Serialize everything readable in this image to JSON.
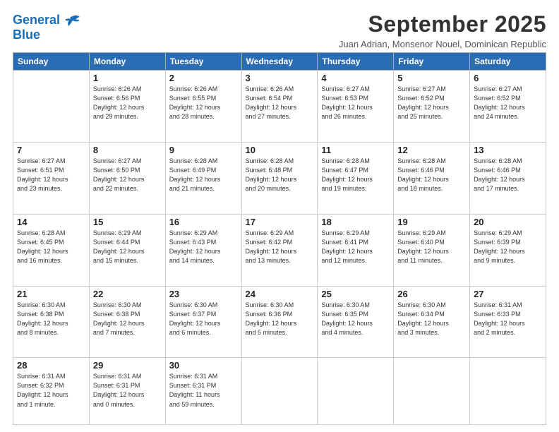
{
  "header": {
    "logo_line1": "General",
    "logo_line2": "Blue",
    "month": "September 2025",
    "location": "Juan Adrian, Monsenor Nouel, Dominican Republic"
  },
  "days_of_week": [
    "Sunday",
    "Monday",
    "Tuesday",
    "Wednesday",
    "Thursday",
    "Friday",
    "Saturday"
  ],
  "weeks": [
    [
      {
        "day": "",
        "info": ""
      },
      {
        "day": "1",
        "info": "Sunrise: 6:26 AM\nSunset: 6:56 PM\nDaylight: 12 hours\nand 29 minutes."
      },
      {
        "day": "2",
        "info": "Sunrise: 6:26 AM\nSunset: 6:55 PM\nDaylight: 12 hours\nand 28 minutes."
      },
      {
        "day": "3",
        "info": "Sunrise: 6:26 AM\nSunset: 6:54 PM\nDaylight: 12 hours\nand 27 minutes."
      },
      {
        "day": "4",
        "info": "Sunrise: 6:27 AM\nSunset: 6:53 PM\nDaylight: 12 hours\nand 26 minutes."
      },
      {
        "day": "5",
        "info": "Sunrise: 6:27 AM\nSunset: 6:52 PM\nDaylight: 12 hours\nand 25 minutes."
      },
      {
        "day": "6",
        "info": "Sunrise: 6:27 AM\nSunset: 6:52 PM\nDaylight: 12 hours\nand 24 minutes."
      }
    ],
    [
      {
        "day": "7",
        "info": "Sunrise: 6:27 AM\nSunset: 6:51 PM\nDaylight: 12 hours\nand 23 minutes."
      },
      {
        "day": "8",
        "info": "Sunrise: 6:27 AM\nSunset: 6:50 PM\nDaylight: 12 hours\nand 22 minutes."
      },
      {
        "day": "9",
        "info": "Sunrise: 6:28 AM\nSunset: 6:49 PM\nDaylight: 12 hours\nand 21 minutes."
      },
      {
        "day": "10",
        "info": "Sunrise: 6:28 AM\nSunset: 6:48 PM\nDaylight: 12 hours\nand 20 minutes."
      },
      {
        "day": "11",
        "info": "Sunrise: 6:28 AM\nSunset: 6:47 PM\nDaylight: 12 hours\nand 19 minutes."
      },
      {
        "day": "12",
        "info": "Sunrise: 6:28 AM\nSunset: 6:46 PM\nDaylight: 12 hours\nand 18 minutes."
      },
      {
        "day": "13",
        "info": "Sunrise: 6:28 AM\nSunset: 6:46 PM\nDaylight: 12 hours\nand 17 minutes."
      }
    ],
    [
      {
        "day": "14",
        "info": "Sunrise: 6:28 AM\nSunset: 6:45 PM\nDaylight: 12 hours\nand 16 minutes."
      },
      {
        "day": "15",
        "info": "Sunrise: 6:29 AM\nSunset: 6:44 PM\nDaylight: 12 hours\nand 15 minutes."
      },
      {
        "day": "16",
        "info": "Sunrise: 6:29 AM\nSunset: 6:43 PM\nDaylight: 12 hours\nand 14 minutes."
      },
      {
        "day": "17",
        "info": "Sunrise: 6:29 AM\nSunset: 6:42 PM\nDaylight: 12 hours\nand 13 minutes."
      },
      {
        "day": "18",
        "info": "Sunrise: 6:29 AM\nSunset: 6:41 PM\nDaylight: 12 hours\nand 12 minutes."
      },
      {
        "day": "19",
        "info": "Sunrise: 6:29 AM\nSunset: 6:40 PM\nDaylight: 12 hours\nand 11 minutes."
      },
      {
        "day": "20",
        "info": "Sunrise: 6:29 AM\nSunset: 6:39 PM\nDaylight: 12 hours\nand 9 minutes."
      }
    ],
    [
      {
        "day": "21",
        "info": "Sunrise: 6:30 AM\nSunset: 6:38 PM\nDaylight: 12 hours\nand 8 minutes."
      },
      {
        "day": "22",
        "info": "Sunrise: 6:30 AM\nSunset: 6:38 PM\nDaylight: 12 hours\nand 7 minutes."
      },
      {
        "day": "23",
        "info": "Sunrise: 6:30 AM\nSunset: 6:37 PM\nDaylight: 12 hours\nand 6 minutes."
      },
      {
        "day": "24",
        "info": "Sunrise: 6:30 AM\nSunset: 6:36 PM\nDaylight: 12 hours\nand 5 minutes."
      },
      {
        "day": "25",
        "info": "Sunrise: 6:30 AM\nSunset: 6:35 PM\nDaylight: 12 hours\nand 4 minutes."
      },
      {
        "day": "26",
        "info": "Sunrise: 6:30 AM\nSunset: 6:34 PM\nDaylight: 12 hours\nand 3 minutes."
      },
      {
        "day": "27",
        "info": "Sunrise: 6:31 AM\nSunset: 6:33 PM\nDaylight: 12 hours\nand 2 minutes."
      }
    ],
    [
      {
        "day": "28",
        "info": "Sunrise: 6:31 AM\nSunset: 6:32 PM\nDaylight: 12 hours\nand 1 minute."
      },
      {
        "day": "29",
        "info": "Sunrise: 6:31 AM\nSunset: 6:31 PM\nDaylight: 12 hours\nand 0 minutes."
      },
      {
        "day": "30",
        "info": "Sunrise: 6:31 AM\nSunset: 6:31 PM\nDaylight: 11 hours\nand 59 minutes."
      },
      {
        "day": "",
        "info": ""
      },
      {
        "day": "",
        "info": ""
      },
      {
        "day": "",
        "info": ""
      },
      {
        "day": "",
        "info": ""
      }
    ]
  ]
}
